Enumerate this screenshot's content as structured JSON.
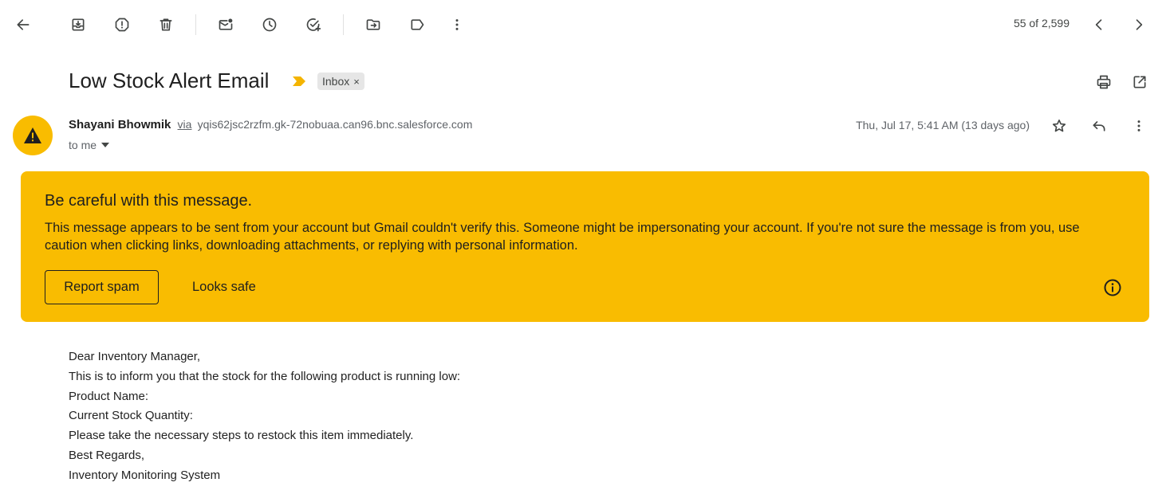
{
  "toolbar": {
    "back_icon": "arrow-left-icon",
    "archive_icon": "archive-icon",
    "report_spam_icon": "report-icon",
    "delete_icon": "trash-icon",
    "mark_unread_icon": "mark-unread-icon",
    "snooze_icon": "clock-icon",
    "add_task_icon": "add-task-icon",
    "move_to_icon": "folder-move-icon",
    "labels_icon": "label-icon",
    "more_icon": "more-vert-icon",
    "counter": "55 of 2,599",
    "prev_icon": "chevron-left-icon",
    "next_icon": "chevron-right-icon"
  },
  "header": {
    "subject": "Low Stock Alert Email",
    "label_chip": "Inbox",
    "label_remove": "×",
    "print_icon": "print-icon",
    "open_new_window_icon": "open-in-new-icon"
  },
  "message": {
    "sender_name": "Shayani Bhowmik",
    "via": "via",
    "sender_address": "yqis62jsc2rzfm.gk-72nobuaa.can96.bnc.salesforce.com",
    "to": "to me",
    "date": "Thu, Jul 17, 5:41 AM (13 days ago)"
  },
  "warning": {
    "title": "Be careful with this message.",
    "body": "This message appears to be sent from your account but Gmail couldn't verify this. Someone might be impersonating your account. If you're not sure the message is from you, use caution when clicking links, downloading attachments, or replying with personal information.",
    "report_spam": "Report spam",
    "looks_safe": "Looks safe"
  },
  "body": {
    "lines": [
      "Dear Inventory Manager,",
      "This is to inform you that the stock for the following product is running low:",
      "Product Name:",
      "Current Stock Quantity:",
      "Please take the necessary steps to restock this item immediately.",
      "Best Regards,",
      "Inventory Monitoring System"
    ]
  },
  "colors": {
    "warning_background": "#f9bc01",
    "avatar_background": "#f9bc00",
    "important_marker": "#f4b400"
  }
}
